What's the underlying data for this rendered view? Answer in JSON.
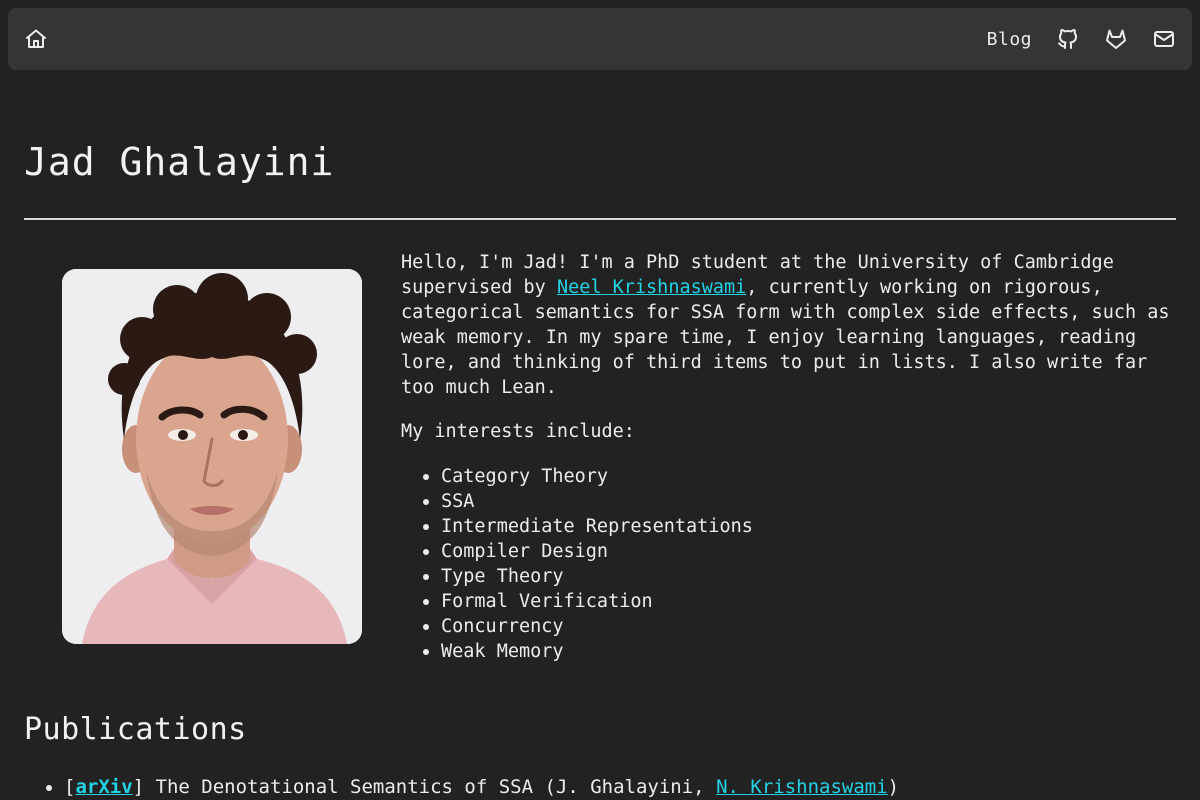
{
  "nav": {
    "home_icon": "home-icon",
    "blog_label": "Blog",
    "icons": [
      "github-icon",
      "gitlab-icon",
      "mail-icon"
    ]
  },
  "page": {
    "title": "Jad Ghalayini"
  },
  "profile_photo": {
    "alt": "Jad Ghalayini"
  },
  "bio": {
    "part1": "Hello, I'm Jad! I'm a PhD student at the University of Cambridge supervised by ",
    "supervisor_link": "Neel Krishnaswami",
    "part2": ", currently working on rigorous, categorical semantics for SSA form with complex side effects, such as weak memory. In my spare time, I enjoy learning languages, reading lore, and thinking of third items to put in lists. I also write far too much Lean."
  },
  "interests": {
    "intro": "My interests include:",
    "items": [
      "Category Theory",
      "SSA",
      "Intermediate Representations",
      "Compiler Design",
      "Type Theory",
      "Formal Verification",
      "Concurrency",
      "Weak Memory"
    ]
  },
  "publications": {
    "heading": "Publications",
    "items": [
      {
        "open_bracket": "[",
        "tag": "arXiv",
        "close_bracket": "]",
        "text": " The Denotational Semantics of SSA (J. Ghalayini, ",
        "coauthor_link": "N. Krishnaswami",
        "closing": ")"
      }
    ]
  },
  "colors": {
    "background": "#222222",
    "navbar": "#353535",
    "link": "#22d3e6",
    "text": "#ececec"
  }
}
